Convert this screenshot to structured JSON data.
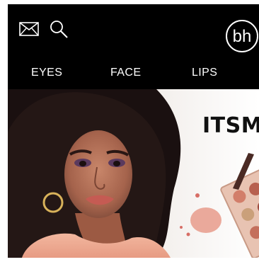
{
  "header": {
    "mail_icon": "envelope-icon",
    "search_icon": "search-icon",
    "logo_text": "bh"
  },
  "nav": {
    "items": [
      {
        "label": "EYES"
      },
      {
        "label": "FACE"
      },
      {
        "label": "LIPS"
      }
    ]
  },
  "hero": {
    "headline": "ITSMY",
    "image": "woman-portrait-with-makeup-palette"
  },
  "colors": {
    "header_bg": "#000000",
    "nav_text": "#ffffff",
    "hero_bg": "#fcfbfb"
  }
}
